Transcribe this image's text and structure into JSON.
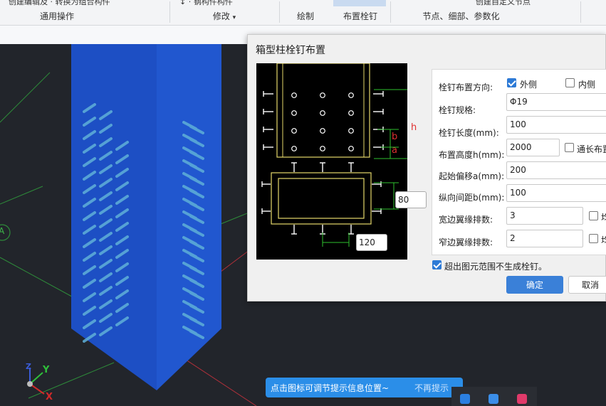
{
  "ribbon": {
    "groups": [
      {
        "caption": "通用操作",
        "top_text": "创建编辑及 · 转换为组合构件"
      },
      {
        "caption": "修改",
        "top_text": "↕ · 钢构件构件"
      },
      {
        "caption": "绘制",
        "top_text": ""
      },
      {
        "caption": "布置栓钉",
        "top_text": ""
      },
      {
        "caption": "节点、细部、参数化",
        "top_text": "创建自定义节点"
      }
    ],
    "modify_dropdown": "▾"
  },
  "dialog": {
    "title": "箱型柱栓钉布置",
    "preview": {
      "dim_80": "80",
      "dim_120": "120",
      "label_h": "h",
      "label_b": "b",
      "label_a": "a"
    },
    "fields": {
      "direction_label": "栓钉布置方向:",
      "outer_label": "外侧",
      "inner_label": "内侧",
      "spec_label": "栓钉规格:",
      "spec_value": "Φ19",
      "length_label": "栓钉长度(mm):",
      "length_value": "100",
      "height_label": "布置高度h(mm):",
      "height_value": "2000",
      "full_length_label": "通长布置",
      "offset_label": "起始偏移a(mm):",
      "offset_value": "200",
      "spacing_label": "纵向间距b(mm):",
      "spacing_value": "100",
      "wide_rows_label": "宽边翼缘排数:",
      "wide_rows_value": "3",
      "narrow_rows_label": "窄边翼缘排数:",
      "narrow_rows_value": "2",
      "even_label": "均",
      "outer_checked": true,
      "inner_checked": false,
      "full_length_checked": false
    },
    "out_of_range_label": "超出图元范围不生成栓钉。",
    "out_of_range_checked": true,
    "ok": "确定",
    "cancel": "取消"
  },
  "viewport": {
    "axis_label": "A",
    "x_label": "X",
    "y_label": "Y",
    "z_label": "Z"
  },
  "toast": {
    "message": "点击图标可调节提示信息位置~",
    "dismiss": "不再提示"
  },
  "colors": {
    "column": "#1d4fc4",
    "accent": "#3a80d8",
    "toast": "#2b8ee8"
  }
}
